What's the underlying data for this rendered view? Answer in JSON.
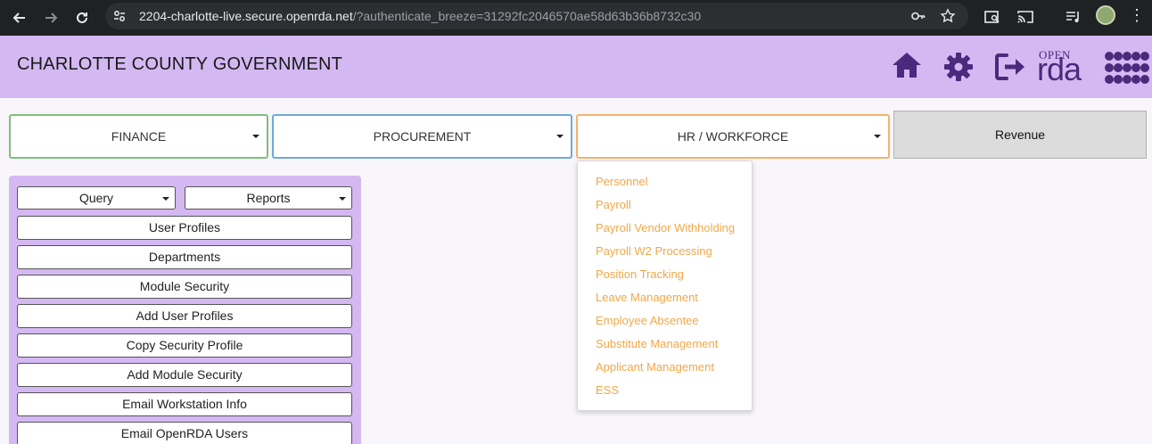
{
  "browser": {
    "url_host": "2204-charlotte-live.secure.openrda.net",
    "url_rest": "/?authenticate_breeze=31292fc2046570ae58d63b36b8732c30"
  },
  "header": {
    "title": "CHARLOTTE COUNTY GOVERNMENT",
    "logo_open": "OPEN",
    "logo_rda": "rda",
    "icons": [
      "home-icon",
      "gear-icon",
      "logout-icon"
    ]
  },
  "modules": {
    "finance": "FINANCE",
    "procurement": "PROCUREMENT",
    "hr": "HR / WORKFORCE",
    "revenue": "Revenue"
  },
  "hr_menu": {
    "items": [
      "Personnel",
      "Payroll",
      "Payroll Vendor Withholding",
      "Payroll W2 Processing",
      "Position Tracking",
      "Leave Management",
      "Employee Absentee",
      "Substitute Management",
      "Applicant Management",
      "ESS"
    ]
  },
  "panel": {
    "query": "Query",
    "reports": "Reports",
    "buttons": [
      "User Profiles",
      "Departments",
      "Module Security",
      "Add User Profiles",
      "Copy Security Profile",
      "Add Module Security",
      "Email Workstation Info",
      "Email OpenRDA Users"
    ]
  },
  "colors": {
    "header_bg": "#d4b8f2",
    "brand_purple": "#4b2a7d",
    "finance_border": "#7fbf7a",
    "procurement_border": "#6fa8dc",
    "hr_border": "#f6b26b",
    "menu_text": "#f0a848"
  }
}
